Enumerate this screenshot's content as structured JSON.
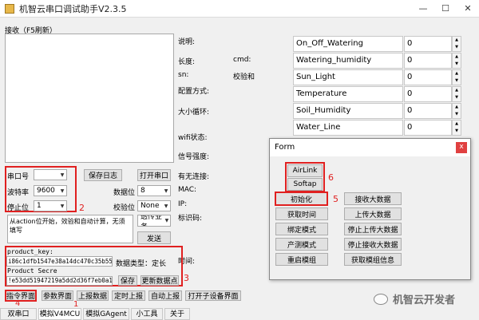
{
  "window": {
    "title": "机智云串口调试助手V2.3.5",
    "minimize": "—",
    "maximize": "☐",
    "close": "✕"
  },
  "receive": {
    "label": "接收（F5刷新）"
  },
  "info": {
    "desc": "说明:",
    "length": "长度:",
    "cmd": "cmd:",
    "sn": "sn:",
    "checksum": "校验和",
    "config_mode": "配置方式:",
    "loop_size": "大小循环:",
    "wifi_status": "wifi状态:",
    "signal": "信号强度:",
    "connected": "有无连接:",
    "mac": "MAC:",
    "ip": "IP:",
    "ident": "标识码:",
    "time": "时间:"
  },
  "serial": {
    "port_label": "串口号",
    "port_value": "",
    "baud_label": "波特率",
    "baud_value": "9600",
    "stop_label": "停止位",
    "stop_value": "1",
    "data_label": "数据位",
    "data_value": "8",
    "parity_label": "校验位",
    "parity_value": "None",
    "save_log": "保存日志",
    "open_port": "打开串口",
    "mode_value": "透传业务"
  },
  "send": {
    "hint": "从action位开始，效验和自动计算，无须填写",
    "send_button": "发送"
  },
  "product": {
    "key_label": "product_key:",
    "key_value": "i86c1dfb1547e38a14dc470c35b555",
    "data_type": "数据类型：定长",
    "secret_label": "Product Secre",
    "secret_value": "!e53dd51947219a5dd2d36f7eb0a1",
    "save": "保存",
    "update": "更新数据点"
  },
  "bottom_buttons": {
    "cmd_interface": "指令界面",
    "param_interface": "参数界面",
    "report_data": "上报数据",
    "timed_report": "定时上报",
    "auto_report": "自动上报",
    "open_device": "打开子设备界面"
  },
  "tabs": [
    "双串口",
    "模拟V4MCU",
    "模拟GAgent",
    "小工具",
    "关于"
  ],
  "annotations": [
    "1",
    "2",
    "3",
    "4",
    "5",
    "6"
  ],
  "datapoints": [
    {
      "name": "On_Off_Watering",
      "value": "0"
    },
    {
      "name": "Watering_humidity",
      "value": "0"
    },
    {
      "name": "Sun_Light",
      "value": "0"
    },
    {
      "name": "Temperature",
      "value": "0"
    },
    {
      "name": "Soil_Humidity",
      "value": "0"
    },
    {
      "name": "Water_Line",
      "value": "0"
    }
  ],
  "form": {
    "title": "Form",
    "close": "x",
    "airlink": "AirLink",
    "softap": "Softap",
    "init": "初始化",
    "get_time": "获取时间",
    "bind_mode": "绑定模式",
    "factory_mode": "产测模式",
    "restart": "重启模组",
    "recv_big": "接收大数据",
    "upload_big": "上传大数据",
    "stop_upload": "停止上传大数据",
    "stop_recv": "停止接收大数据",
    "module_info": "获取模组信息"
  },
  "watermark": "机智云开发者"
}
